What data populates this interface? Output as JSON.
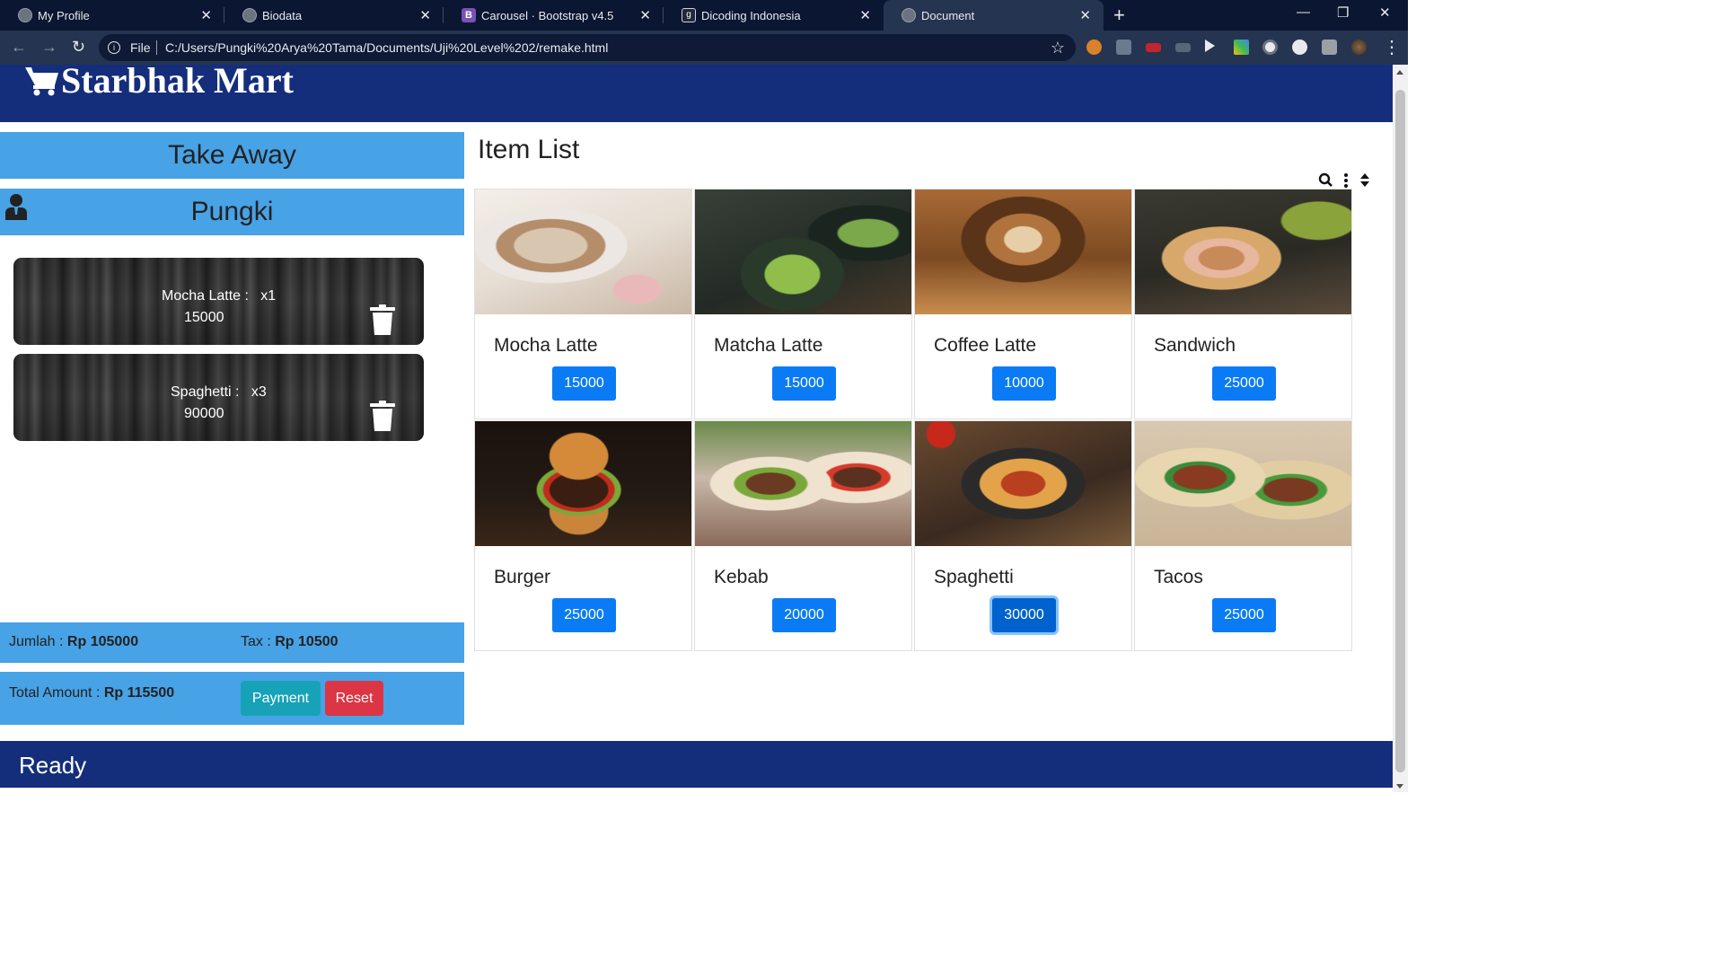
{
  "browser": {
    "tabs": [
      {
        "title": "My Profile",
        "close": "✕"
      },
      {
        "title": "Biodata",
        "close": "✕"
      },
      {
        "title": "Carousel · Bootstrap v4.5",
        "close": "✕",
        "favicon_letter": "B"
      },
      {
        "title": "Dicoding Indonesia",
        "close": "✕",
        "favicon_letter": "g"
      },
      {
        "title": "Document",
        "close": "✕",
        "active": true
      }
    ],
    "new_tab": "+",
    "address": {
      "scheme_label": "File",
      "url": "C:/Users/Pungki%20Arya%20Tama/Documents/Uji%20Level%202/remake.html"
    },
    "controls": {
      "back": "←",
      "forward": "→",
      "reload": "↻",
      "star": "☆",
      "minimize": "—",
      "restore": "❐",
      "close": "✕",
      "menu": "⋮"
    }
  },
  "header": {
    "brand": "Starbhak Mart"
  },
  "order": {
    "mode": "Take Away",
    "customer": "Pungki",
    "cart": [
      {
        "name": "Mocha Latte",
        "qty": "x1",
        "line": "Mocha Latte :   x1",
        "subtotal": "15000"
      },
      {
        "name": "Spaghetti",
        "qty": "x3",
        "line": "Spaghetti :   x3",
        "subtotal": "90000"
      }
    ]
  },
  "summary": {
    "jumlah_label": "Jumlah :",
    "jumlah_value": "Rp 105000",
    "tax_label": "Tax :",
    "tax_value": "Rp 10500",
    "total_label": "Total Amount :",
    "total_value": "Rp 115500",
    "payment_button": "Payment",
    "reset_button": "Reset"
  },
  "item_list": {
    "title": "Item List",
    "items": [
      {
        "name": "Mocha Latte",
        "price": "15000",
        "image": "mocha-latte-photo"
      },
      {
        "name": "Matcha Latte",
        "price": "15000",
        "image": "matcha-latte-photo"
      },
      {
        "name": "Coffee Latte",
        "price": "10000",
        "image": "coffee-latte-photo"
      },
      {
        "name": "Sandwich",
        "price": "25000",
        "image": "sandwich-photo"
      },
      {
        "name": "Burger",
        "price": "25000",
        "image": "burger-photo"
      },
      {
        "name": "Kebab",
        "price": "20000",
        "image": "kebab-photo"
      },
      {
        "name": "Spaghetti",
        "price": "30000",
        "image": "spaghetti-photo",
        "focused": true
      },
      {
        "name": "Tacos",
        "price": "25000",
        "image": "tacos-photo"
      }
    ]
  },
  "footer": {
    "status": "Ready"
  },
  "colors": {
    "navy": "#142e7b",
    "panel_blue": "#48a2e6",
    "price_blue": "#0a7bf5",
    "payment_teal": "#17a2b8",
    "reset_red": "#dc3545"
  }
}
